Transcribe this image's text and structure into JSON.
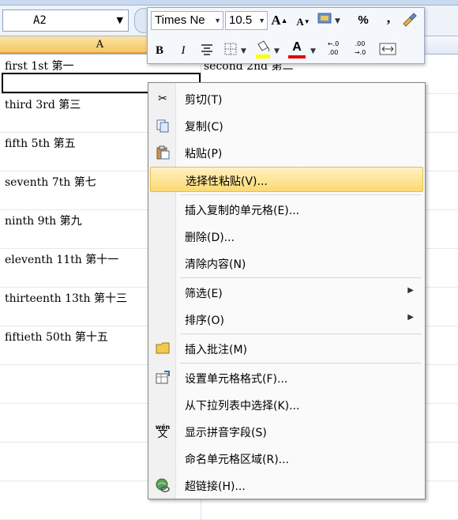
{
  "name_box": {
    "value": "A2"
  },
  "columns": {
    "a_header": "A"
  },
  "cells": {
    "a1": "first  1st 第一",
    "b1": "second   2nd  第二",
    "a3": "third  3rd  第三",
    "a5": "fifth  5th  第五",
    "a7": "seventh  7th  第七",
    "a9": "ninth  9th  第九",
    "a11": "eleventh  11th  第十一",
    "a13": "thirteenth  13th  第十三",
    "a15": "fiftieth   50th  第十五"
  },
  "mini_toolbar": {
    "font_name": "Times Ne",
    "font_size": "10.5",
    "grow_font": "A",
    "shrink_font": "A",
    "percent": "%",
    "comma": ",",
    "bold": "B",
    "italic": "I",
    "font_color": "A",
    "inc_decimal_top": "←.0",
    "inc_decimal_bottom": ".00",
    "dec_decimal_top": ".00",
    "dec_decimal_bottom": "→.0"
  },
  "context_menu": {
    "items": [
      {
        "label": "剪切(T)",
        "icon": "scissors-icon"
      },
      {
        "label": "复制(C)",
        "icon": "copy-icon"
      },
      {
        "label": "粘贴(P)",
        "icon": "paste-icon"
      },
      {
        "label": "选择性粘贴(V)...",
        "highlighted": true
      },
      {
        "label": "插入复制的单元格(E)..."
      },
      {
        "label": "删除(D)..."
      },
      {
        "label": "清除内容(N)"
      },
      {
        "label": "筛选(E)",
        "submenu": true
      },
      {
        "label": "排序(O)",
        "submenu": true
      },
      {
        "label": "插入批注(M)",
        "icon": "comment-icon"
      },
      {
        "label": "设置单元格格式(F)...",
        "icon": "format-cells-icon"
      },
      {
        "label": "从下拉列表中选择(K)..."
      },
      {
        "label": "显示拼音字段(S)",
        "icon": "phonetic-icon"
      },
      {
        "label": "命名单元格区域(R)..."
      },
      {
        "label": "超链接(H)...",
        "icon": "hyperlink-icon"
      }
    ],
    "phonetic_icon_text": "wén",
    "phonetic_icon_char": "文"
  },
  "colors": {
    "highlight": "#fcd971",
    "selected_header": "#f5c766",
    "font_color_bar": "#e00000",
    "fill_color_bar": "#ffff00"
  }
}
